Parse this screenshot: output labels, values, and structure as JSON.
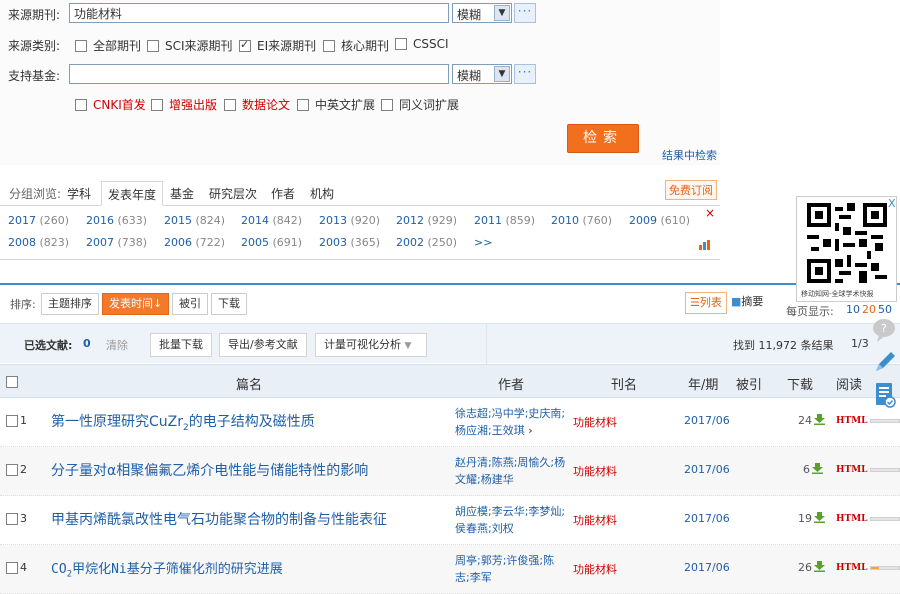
{
  "search": {
    "source_label": "来源期刊:",
    "source_value": "功能材料",
    "source_mode": "模糊",
    "category_label": "来源类别:",
    "categories": [
      {
        "label": "全部期刊",
        "checked": false
      },
      {
        "label": "SCI来源期刊",
        "checked": false
      },
      {
        "label": "EI来源期刊",
        "checked": true
      },
      {
        "label": "核心期刊",
        "checked": false
      },
      {
        "label": "CSSCI",
        "checked": false
      }
    ],
    "fund_label": "支持基金:",
    "fund_value": "",
    "fund_mode": "模糊",
    "more_label": "···",
    "options": [
      {
        "label": "CNKI首发",
        "red": true
      },
      {
        "label": "增强出版",
        "red": true
      },
      {
        "label": "数据论文",
        "red": true
      },
      {
        "label": "中英文扩展",
        "red": false
      },
      {
        "label": "同义词扩展",
        "red": false
      }
    ],
    "search_button": "检索",
    "search_in_results": "结果中检索"
  },
  "group_browse": {
    "label": "分组浏览:",
    "tabs": [
      "学科",
      "发表年度",
      "基金",
      "研究层次",
      "作者",
      "机构"
    ],
    "active_tab": "发表年度",
    "free_subscribe": "免费订阅",
    "years_row1": [
      {
        "year": "2017",
        "count": "(260)"
      },
      {
        "year": "2016",
        "count": "(633)"
      },
      {
        "year": "2015",
        "count": "(824)"
      },
      {
        "year": "2014",
        "count": "(842)"
      },
      {
        "year": "2013",
        "count": "(920)"
      },
      {
        "year": "2012",
        "count": "(929)"
      },
      {
        "year": "2011",
        "count": "(859)"
      },
      {
        "year": "2010",
        "count": "(760)"
      },
      {
        "year": "2009",
        "count": "(610)"
      }
    ],
    "years_row2": [
      {
        "year": "2008",
        "count": "(823)"
      },
      {
        "year": "2007",
        "count": "(738)"
      },
      {
        "year": "2006",
        "count": "(722)"
      },
      {
        "year": "2005",
        "count": "(691)"
      },
      {
        "year": "2003",
        "count": "(365)"
      },
      {
        "year": "2002",
        "count": "(250)"
      }
    ],
    "more_years": ">>",
    "close": "×"
  },
  "sort": {
    "label": "排序:",
    "options": [
      "主题排序",
      "发表时间",
      "被引",
      "下载"
    ],
    "active": "发表时间",
    "view_list": "列表",
    "view_abstract": "摘要",
    "per_page_label": "每页显示:",
    "per_page_options": [
      "10",
      "20",
      "50"
    ],
    "per_page_active": "20"
  },
  "selected": {
    "label": "已选文献:",
    "count": "0",
    "clear": "清除",
    "batch_download": "批量下载",
    "export": "导出/参考文献",
    "visual": "计量可视化分析",
    "found": "找到 11,972 条结果",
    "page": "1/3"
  },
  "table": {
    "headers": [
      "篇名",
      "作者",
      "刊名",
      "年/期",
      "被引",
      "下载",
      "阅读"
    ],
    "rows": [
      {
        "num": "1",
        "title": "第一性原理研究CuZr2的电子结构及磁性质",
        "authors": "徐志超;冯中学;史庆南;杨应湘;王效琪",
        "journal": "功能材料",
        "date": "2017/06",
        "downloads": "24",
        "read": "HTML",
        "bar": 0
      },
      {
        "num": "2",
        "title": "分子量对α相聚偏氟乙烯介电性能与储能特性的影响",
        "authors": "赵丹清;陈燕;周愉久;杨文耀;杨建华",
        "journal": "功能材料",
        "date": "2017/06",
        "downloads": "6",
        "read": "HTML",
        "bar": 0
      },
      {
        "num": "3",
        "title": "甲基丙烯酰氯改性电气石功能聚合物的制备与性能表征",
        "authors": "胡应模;李云华;李梦灿;侯春燕;刘权",
        "journal": "功能材料",
        "date": "2017/06",
        "downloads": "19",
        "read": "HTML",
        "bar": 0
      },
      {
        "num": "4",
        "title": "CO2甲烷化Ni基分子筛催化剂的研究进展",
        "authors": "周亭;郭芳;许俊强;陈志;李军",
        "journal": "功能材料",
        "date": "2017/06",
        "downloads": "26",
        "read": "HTML",
        "bar": 0.3
      }
    ]
  },
  "qr": {
    "caption": "移动知网-全球学术快报",
    "close": "X"
  },
  "colors": {
    "accent": "#f37a2b",
    "link": "#1f5fa8",
    "red": "#cc0000"
  }
}
